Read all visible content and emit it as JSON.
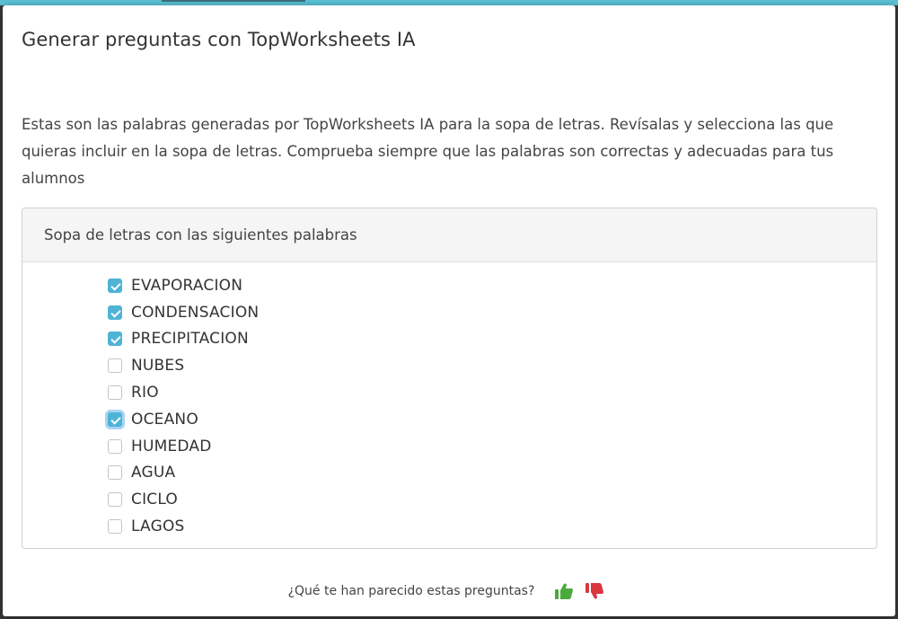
{
  "dialog": {
    "title": "Generar preguntas con TopWorksheets IA",
    "intro": "Estas son las palabras generadas por TopWorksheets IA para la sopa de letras. Revísalas y selecciona las que quieras incluir en la sopa de letras. Comprueba siempre que las palabras son correctas y adecuadas para tus alumnos"
  },
  "card": {
    "header": "Sopa de letras con las siguientes palabras",
    "words": [
      {
        "label": "EVAPORACION",
        "checked": true
      },
      {
        "label": "CONDENSACION",
        "checked": true
      },
      {
        "label": "PRECIPITACION",
        "checked": true
      },
      {
        "label": "NUBES",
        "checked": false
      },
      {
        "label": "RIO",
        "checked": false
      },
      {
        "label": "OCEANO",
        "checked": true,
        "focused": true
      },
      {
        "label": "HUMEDAD",
        "checked": false
      },
      {
        "label": "AGUA",
        "checked": false
      },
      {
        "label": "CICLO",
        "checked": false
      },
      {
        "label": "LAGOS",
        "checked": false
      }
    ]
  },
  "feedback": {
    "question": "¿Qué te han parecido estas preguntas?",
    "thumbs_up_icon": "thumbs-up-icon",
    "thumbs_down_icon": "thumbs-down-icon"
  },
  "colors": {
    "accent": "#5bc3d7",
    "checkbox_checked": "#4fb3d6",
    "thumbs_up": "#4caa3c",
    "thumbs_down": "#d9363e"
  }
}
